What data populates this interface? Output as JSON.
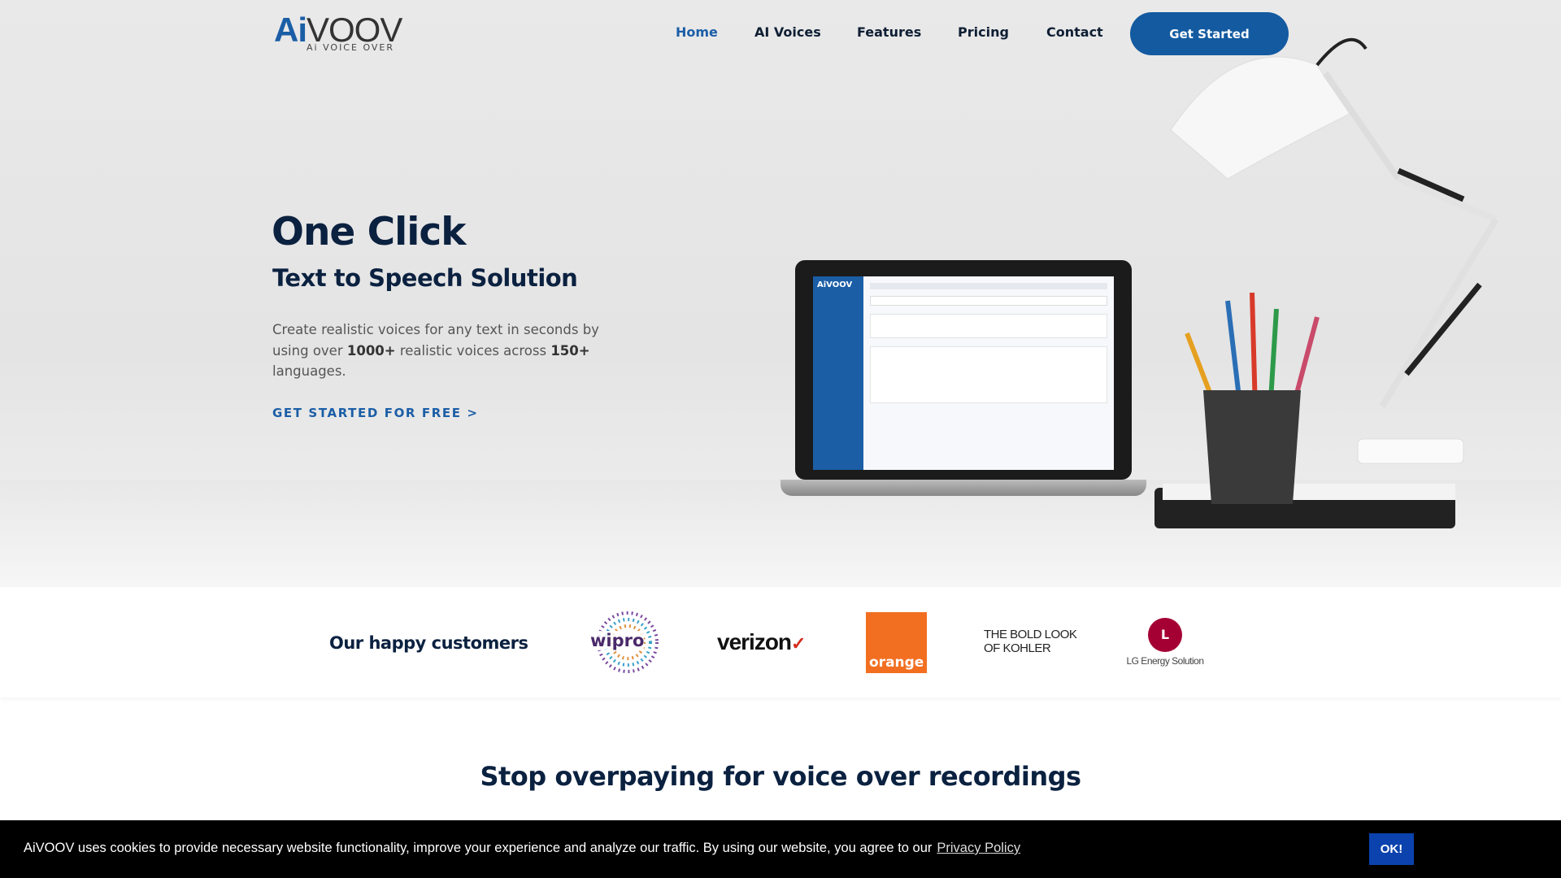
{
  "header": {
    "logo": {
      "ai": "Ai",
      "voov": "VOOV",
      "tagline": "Ai VOICE OVER"
    },
    "nav": [
      {
        "label": "Home",
        "active": true
      },
      {
        "label": "AI Voices"
      },
      {
        "label": "Features"
      },
      {
        "label": "Pricing"
      },
      {
        "label": "Contact"
      }
    ],
    "cta_label": "Get Started"
  },
  "hero": {
    "title": "One Click",
    "subtitle": "Text to Speech Solution",
    "desc_1": "Create realistic voices for any text in seconds by using over ",
    "desc_bold_1": "1000+",
    "desc_2": " realistic voices across ",
    "desc_bold_2": "150+",
    "desc_3": " languages.",
    "cta": "GET STARTED FOR FREE >",
    "laptop_screen_logo": "AiVOOV"
  },
  "customers": {
    "title": "Our happy customers",
    "logos": [
      "wipro",
      "verizon",
      "orange",
      "THE BOLD LOOK OF KOHLER",
      "LG Energy Solution"
    ]
  },
  "section_heading": "Stop overpaying for voice over recordings",
  "cookie": {
    "message": "AiVOOV uses cookies to provide necessary website functionality, improve your experience and analyze our traffic. By using our website, you agree to our",
    "link": "Privacy Policy",
    "ok": "OK!"
  },
  "colors": {
    "brand": "#135aa0",
    "heading": "#0b2140",
    "cookie_button": "#0b42ad",
    "orange": "#f26f21",
    "lg": "#a50034"
  }
}
